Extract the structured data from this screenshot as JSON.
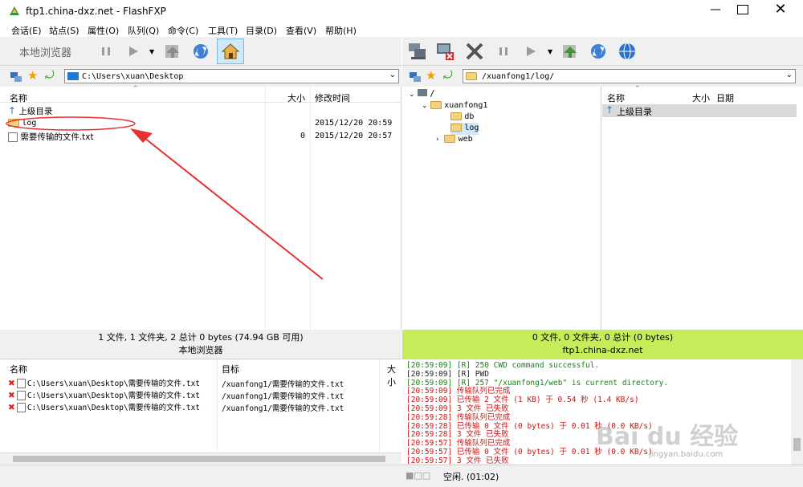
{
  "window": {
    "title": "ftp1.china-dxz.net - FlashFXP"
  },
  "menu": [
    "会话(E)",
    "站点(S)",
    "属性(O)",
    "队列(Q)",
    "命令(C)",
    "工具(T)",
    "目录(D)",
    "查看(V)",
    "帮助(H)"
  ],
  "left": {
    "toolbar_label": "本地浏览器",
    "path": "C:\\Users\\xuan\\Desktop",
    "cols": {
      "name": "名称",
      "size": "大小",
      "mtime": "修改时间"
    },
    "rows": [
      {
        "name": "上级目录",
        "size": "",
        "mtime": ""
      },
      {
        "name": "log",
        "size": "",
        "mtime": "2015/12/20 20:59"
      },
      {
        "name": "需要传输的文件.txt",
        "size": "0",
        "mtime": "2015/12/20 20:57"
      }
    ],
    "status1": "1 文件, 1 文件夹, 2 总计 0 bytes (74.94 GB 可用)",
    "status2": "本地浏览器"
  },
  "right": {
    "path": "/xuanfong1/log/",
    "tree": [
      "/",
      "xuanfong1",
      "db",
      "log",
      "web"
    ],
    "cols": {
      "name": "名称",
      "size": "大小",
      "date": "日期"
    },
    "rows": [
      {
        "name": "上级目录"
      }
    ],
    "status1": "0 文件, 0 文件夹, 0 总计 (0 bytes)",
    "status2": "ftp1.china-dxz.net"
  },
  "queue": {
    "cols": {
      "name": "名称",
      "target": "目标",
      "size": "大小"
    },
    "rows": [
      {
        "name": "C:\\Users\\xuan\\Desktop\\需要传输的文件.txt",
        "target": "/xuanfong1/需要传输的文件.txt"
      },
      {
        "name": "C:\\Users\\xuan\\Desktop\\需要传输的文件.txt",
        "target": "/xuanfong1/需要传输的文件.txt"
      },
      {
        "name": "C:\\Users\\xuan\\Desktop\\需要传输的文件.txt",
        "target": "/xuanfong1/需要传输的文件.txt"
      }
    ]
  },
  "log": [
    {
      "t": "[20:59:09] [R] 250 CWD command successful.",
      "c": "green"
    },
    {
      "t": "[20:59:09] [R] PWD",
      "c": "dark"
    },
    {
      "t": "[20:59:09] [R] 257 \"/xuanfong1/web\" is current directory.",
      "c": "green"
    },
    {
      "t": "[20:59:09] 传输队列已完成",
      "c": "red"
    },
    {
      "t": "[20:59:09] 已传输 2 文件 (1 KB) 于 0.54 秒 (1.4 KB/s)",
      "c": "red"
    },
    {
      "t": "[20:59:09] 3 文件 已失败",
      "c": "red"
    },
    {
      "t": "[20:59:28] 传输队列已完成",
      "c": "red"
    },
    {
      "t": "[20:59:28] 已传输 0 文件 (0 bytes) 于 0.01 秒 (0.0 KB/s)",
      "c": "red"
    },
    {
      "t": "[20:59:28] 3 文件 已失败",
      "c": "red"
    },
    {
      "t": "[20:59:57] 传输队列已完成",
      "c": "red"
    },
    {
      "t": "[20:59:57] 已传输 0 文件 (0 bytes) 于 0.01 秒 (0.0 KB/s)",
      "c": "red"
    },
    {
      "t": "[20:59:57] 3 文件 已失败",
      "c": "red"
    }
  ],
  "bottom_status": "空闲. (01:02)",
  "watermark": {
    "main": "Bai du 经验",
    "sub": "jingyan.baidu.com"
  },
  "colors": {
    "log_green": "#118811",
    "log_red": "#cc1111",
    "status_green": "#c6ec5a",
    "annotation": "#e8322f"
  }
}
